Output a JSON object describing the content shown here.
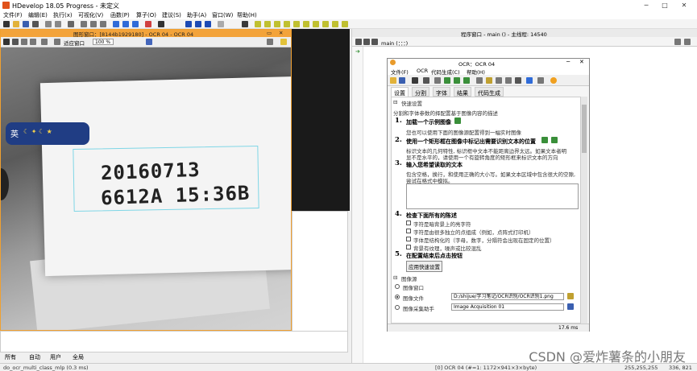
{
  "app": {
    "title": "HDevelop 18.05 Progress - 未定义"
  },
  "menu": [
    "文件(F)",
    "编辑(E)",
    "执行(x)",
    "可视化(V)",
    "函数(P)",
    "算子(O)",
    "建议(S)",
    "助手(A)",
    "窗口(W)",
    "帮助(H)"
  ],
  "graphics": {
    "title": "图形窗口：[8144b1929180] - OCR 04 - OCR 04",
    "fit_label": "适应窗口",
    "zoom": "100 %",
    "ocr_line1": "20160713",
    "ocr_line2": "6612A 15:36B",
    "ime_char": "英"
  },
  "tabs": [
    "所有",
    "自动",
    "用户",
    "全局"
  ],
  "status": {
    "left": "do_ocr_multi_class_mlp (0.3 ms)",
    "mid": "[0] OCR 04 (#=1: 1172×941×3×byte)",
    "right": "255,255,255",
    "coords": "336, 821"
  },
  "program": {
    "title": "程序窗口 - main () - 主线程: 14540",
    "proc": "main (：：：)"
  },
  "ocr": {
    "title": "OCR：OCR 04",
    "menu": [
      "文件(F)",
      "OCR",
      "代码生成(C)",
      "帮助(H)"
    ],
    "tabs": [
      "设置",
      "分割",
      "字体",
      "结果",
      "代码生成"
    ],
    "quick_setup": "快速设置",
    "intro": "分割和字体参数的择配置基于图像内容的描述",
    "step1_num": "1.",
    "step1": "加载一个示例图像",
    "step1_desc": "您也可以使用下面的图像源配置得到一幅实时图像",
    "step2_num": "2.",
    "step2": "使用一个矩形框在图像中标记出需要识别文本的位置",
    "step2_desc1": "标识文本的几何特性, 标识框中文本不能距离边界太远。如果文本者明",
    "step2_desc2": "显不是水平的，请使用一个有旋转角度的矩形框来标识文本的方向",
    "step3_num": "3.",
    "step3": "输入您希望读取的文本",
    "step3_desc1": "包含空格，换行，和使用正确的大小写。如果文本区域中包含很大的空隙,",
    "step3_desc2": "尝试在格式中模拟。",
    "step4_num": "4.",
    "step4": "检查下面所有的陈述",
    "checks": [
      "字符是暗背景上的亮字符",
      "字符是由很多独立的点组成（例如，点阵式打印机）",
      "字体是结构化的（字母，数字，分隔符会出现在固定的位置）",
      "背景有纹理，噪声或比较混乱"
    ],
    "step5_num": "5.",
    "step5": "在配置结束后点击按钮",
    "apply_btn": "应用快速设置",
    "image_source": "图像源",
    "radio_window": "图像窗口",
    "radio_file": "图像文件",
    "file_path": "D:/shijue/学习笔记/OCR识别/OCR识别1.png",
    "radio_acq": "图像采集助手",
    "acq_value": "Image Acquisition 01",
    "status_time": "17.6 ms"
  },
  "watermark": "CSDN @爱炸薯条的小朋友"
}
